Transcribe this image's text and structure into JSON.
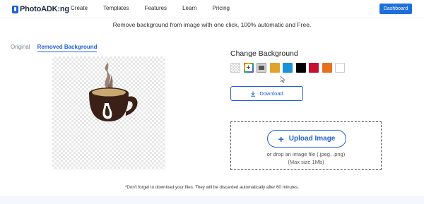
{
  "navbar": {
    "logo_text": "PhotoADK:ng",
    "links": [
      "Create",
      "Templates",
      "Features",
      "Learn",
      "Pricing"
    ],
    "dashboard_label": "Dashboard"
  },
  "subtitle": "Remove background from image with one click, 100% automatic and Free.",
  "tabs": {
    "original": "Original",
    "removed": "Removed Background"
  },
  "change_background": {
    "title": "Change Background",
    "swatches": [
      {
        "type": "transparent"
      },
      {
        "type": "add",
        "icon": "plus-icon"
      },
      {
        "type": "image",
        "icon": "image-icon"
      },
      {
        "type": "color",
        "color": "#e0a32c"
      },
      {
        "type": "color",
        "color": "#1c93d8"
      },
      {
        "type": "color",
        "color": "#000000"
      },
      {
        "type": "color",
        "color": "#c8102e"
      },
      {
        "type": "color",
        "color": "#e86f1e"
      },
      {
        "type": "color",
        "color": "#ffffff"
      }
    ]
  },
  "download_label": "Download",
  "upload": {
    "button_label": "Upload Image",
    "hint": "or drop an image file (.jpeg, .png)",
    "max_size": "(Max size 1Mb)"
  },
  "footnote": "*Don't forget to download your files. They will be discarded automatically after 60 minutes.",
  "colors": {
    "accent": "#1f5fd6",
    "cup": "#3a2016"
  }
}
